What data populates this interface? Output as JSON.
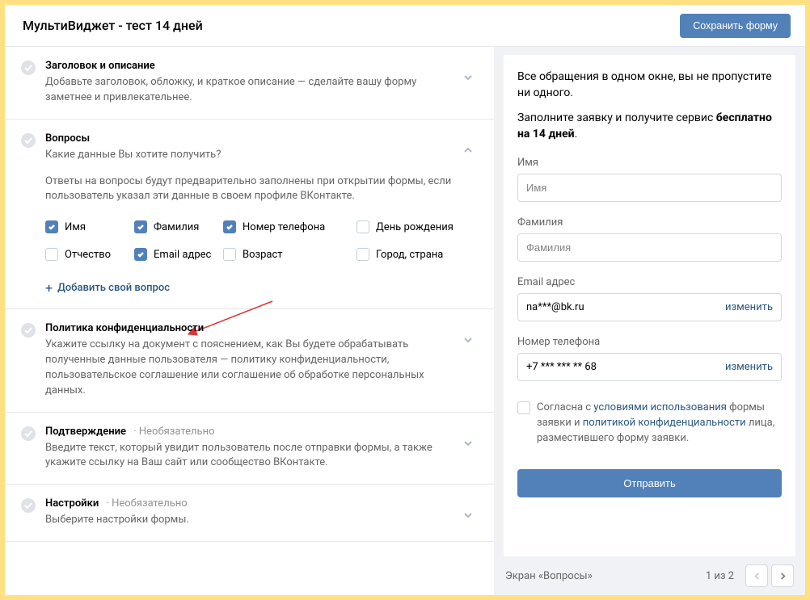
{
  "header": {
    "title": "МультиВиджет - тест 14 дней",
    "save_label": "Сохранить форму"
  },
  "sections": {
    "header_desc": {
      "title": "Заголовок и описание",
      "desc": "Добавьте заголовок, обложку, и краткое описание — сделайте вашу форму заметнее и привлекательнее."
    },
    "questions": {
      "title": "Вопросы",
      "desc": "Какие данные Вы хотите получить?",
      "info": "Ответы на вопросы будут предварительно заполнены при открытии формы, если пользователь указал эти данные в своем профиле ВКонтакте.",
      "add_label": "Добавить свой вопрос",
      "checks": [
        {
          "label": "Имя",
          "checked": true
        },
        {
          "label": "Фамилия",
          "checked": true
        },
        {
          "label": "Номер телефона",
          "checked": true
        },
        {
          "label": "День рождения",
          "checked": false
        },
        {
          "label": "Отчество",
          "checked": false
        },
        {
          "label": "Email адрес",
          "checked": true
        },
        {
          "label": "Возраст",
          "checked": false
        },
        {
          "label": "Город, страна",
          "checked": false
        }
      ]
    },
    "privacy": {
      "title": "Политика конфиденциальности",
      "desc": "Укажите ссылку на документ с пояснением, как Вы будете обрабатывать полученные данные пользователя — политику конфиденциальности, пользовательское соглашение или соглашение об обработке персональных данных."
    },
    "confirm": {
      "title": "Подтверждение",
      "optional": "Необязательно",
      "desc": "Введите текст, который увидит пользователь после отправки формы, а также укажите ссылку на Ваш сайт или сообщество ВКонтакте."
    },
    "settings": {
      "title": "Настройки",
      "optional": "Необязательно",
      "desc": "Выберите настройки формы."
    }
  },
  "preview": {
    "line1": "Все обращения в одном окне, вы не пропустите ни одного.",
    "line2_a": "Заполните заявку и получите сервис ",
    "line2_b": "бесплатно на 14 дней",
    "fields": {
      "name_label": "Имя",
      "name_placeholder": "Имя",
      "surname_label": "Фамилия",
      "surname_placeholder": "Фамилия",
      "email_label": "Email адрес",
      "email_value": "na***@bk.ru",
      "phone_label": "Номер телефона",
      "phone_value": "+7 *** *** ** 68",
      "change_label": "изменить"
    },
    "consent_parts": {
      "a": "Согласна с ",
      "b": "условиями использования",
      "c": " формы заявки и ",
      "d": "политикой конфиденциальности",
      "e": " лица, разместившего форму заявки."
    },
    "submit": "Отправить"
  },
  "footer": {
    "screen_label": "Экран «Вопросы»",
    "pager": "1 из 2"
  }
}
